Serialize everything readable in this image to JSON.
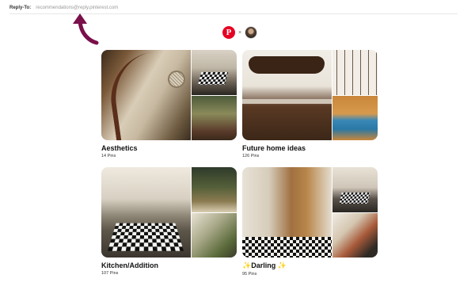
{
  "email": {
    "reply_to_label": "Reply-To:",
    "reply_to_address": "recommendations@reply.pinterest.com"
  },
  "header": {
    "brand_logo": "P",
    "separator": "×",
    "brand_color": "#e60023"
  },
  "annotation": {
    "arrow_color": "#7a0f4a"
  },
  "boards": [
    {
      "name": "Aesthetics",
      "pins": "14 Pins",
      "images": [
        "spiral-staircase-art-nouveau",
        "checkered-sink",
        "green-doorway"
      ]
    },
    {
      "name": "Future home ideas",
      "pins": "126 Pins",
      "images": [
        "retro-kitchen-cabinets",
        "wall-key-rack",
        "blue-hose-reels"
      ]
    },
    {
      "name": "Kitchen/Addition",
      "pins": "107 Pins",
      "images": [
        "checkered-sink-closeup",
        "green-kitchen",
        "sunroom-plants"
      ]
    },
    {
      "name": "✨Darling ✨",
      "pins": "95 Pins",
      "images": [
        "wooden-door-hallway",
        "checkered-sink-small",
        "tiled-staircase"
      ]
    }
  ]
}
